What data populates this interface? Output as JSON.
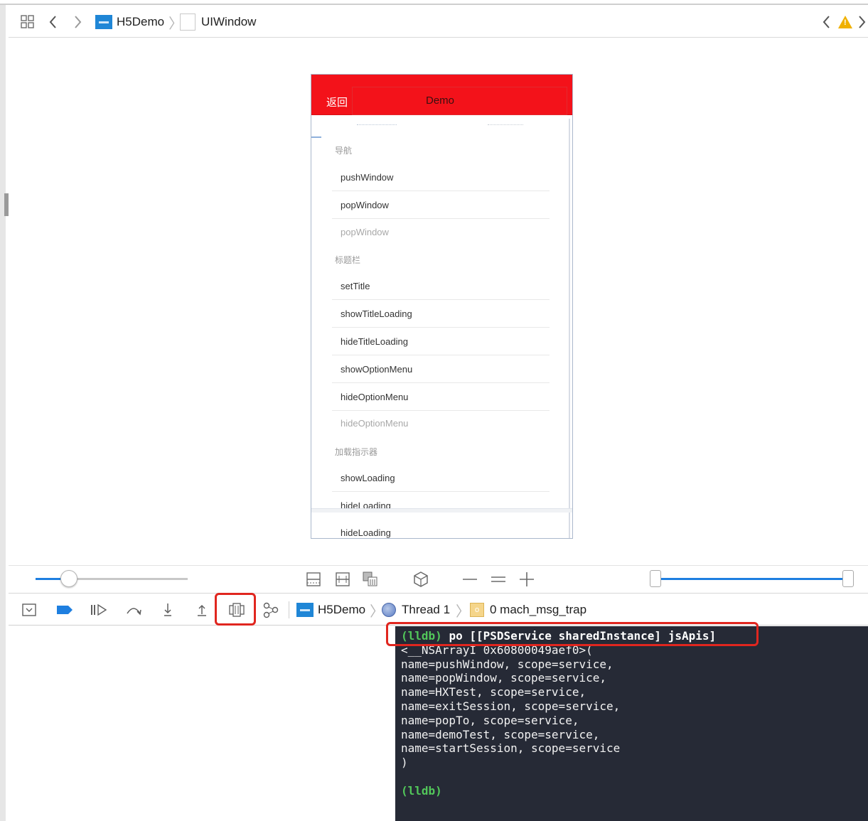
{
  "jumpbar": {
    "project_name": "H5Demo",
    "window_name": "UIWindow"
  },
  "phone": {
    "nav_back": "返回",
    "nav_title": "Demo",
    "sections": [
      {
        "header": "导航",
        "items": [
          "pushWindow",
          "popWindow",
          "popWindow"
        ]
      },
      {
        "header": "标题栏",
        "items": [
          "setTitle",
          "showTitleLoading",
          "hideTitleLoading",
          "showOptionMenu",
          "hideOptionMenu",
          "hideOptionMenu"
        ]
      },
      {
        "header": "加载指示器",
        "items": [
          "showLoading",
          "hideLoading",
          "hideLoading"
        ]
      }
    ]
  },
  "zoom": {
    "slider_value": 0.22,
    "range_low": 0.0,
    "range_high": 1.0
  },
  "debugbar": {
    "project_name": "H5Demo",
    "thread": "Thread 1",
    "frame": "0 mach_msg_trap"
  },
  "console": {
    "prompt": "(lldb)",
    "command": "po [[PSDService sharedInstance] jsApis]",
    "output_lines": [
      "<__NSArrayI 0x60800049aef0>(",
      "name=pushWindow, scope=service,",
      "name=popWindow, scope=service,",
      "name=HXTest, scope=service,",
      "name=exitSession, scope=service,",
      "name=popTo, scope=service,",
      "name=demoTest, scope=service,",
      "name=startSession, scope=service",
      ")"
    ],
    "final_prompt": "(lldb)"
  },
  "colors": {
    "nav_red": "#f3121a",
    "console_bg": "#262a36",
    "prompt_green": "#52c75a",
    "highlight_red": "#e0261f",
    "accent_blue": "#1e7fe0",
    "warning_yellow": "#f0b100"
  }
}
